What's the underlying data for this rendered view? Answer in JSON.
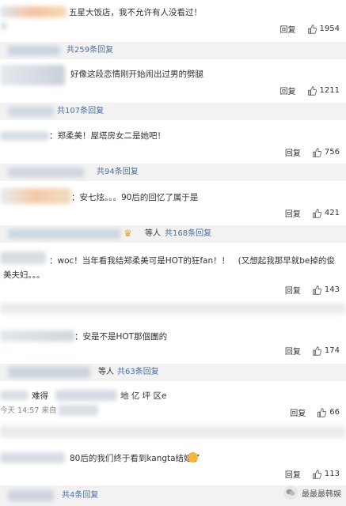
{
  "reply_label": "回复",
  "comments": [
    {
      "text": "五星大饭店，我不允许有人没看过！",
      "likes": "1954"
    },
    {
      "text": "好像这段恋情刚开始闹出过男的劈腿",
      "likes": "1211"
    },
    {
      "text": "：郑柔美！屋塔房女二是她吧！",
      "likes": "756"
    },
    {
      "text": "：安七炫。。。90后的回忆了属于是",
      "likes": "421"
    },
    {
      "text": "：woc！当年看我结郑柔美可是HOT的狂fan！！　(又想起我那早就be掉的俊美夫妇。。。",
      "likes": "143"
    },
    {
      "text": "：安是不是HOT那個團的",
      "likes": "174"
    },
    {
      "text": "难得",
      "location": "地 亿 坪 区e",
      "time": "今天 14:57 来自",
      "likes": "66"
    },
    {
      "text": "80后的我们终于看到kangta结婚了",
      "likes": "113"
    }
  ],
  "replies": [
    {
      "link": "共259条回复",
      "prefix": ""
    },
    {
      "link": "共107条回复",
      "prefix": ""
    },
    {
      "link": "共94条回复",
      "prefix": ""
    },
    {
      "link": "共168条回复",
      "prefix": "等人"
    },
    {
      "link": "共63条回复",
      "prefix": "等人"
    },
    {
      "link": "共4条回复",
      "prefix": ""
    }
  ],
  "watermark": {
    "text": "最最最韩娱"
  },
  "icons": {
    "like": "thumbs-up-icon",
    "watermark": "wechat-logo-icon"
  }
}
